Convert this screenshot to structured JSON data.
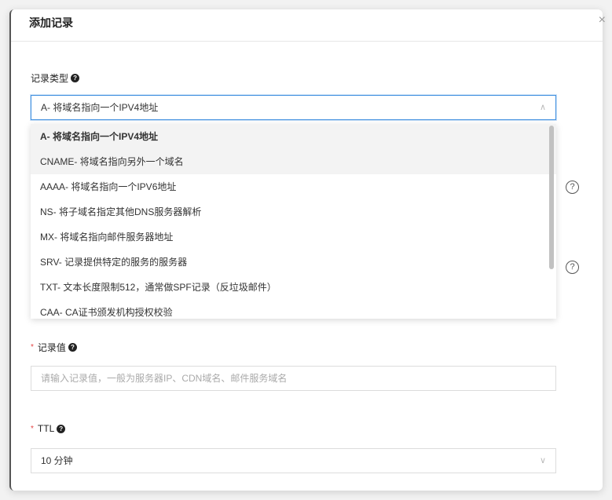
{
  "modal": {
    "title": "添加记录",
    "close": "×"
  },
  "record_type": {
    "label": "记录类型",
    "help": "?",
    "value": "A- 将域名指向一个IPV4地址",
    "arrow": "∧",
    "options": [
      "A- 将域名指向一个IPV4地址",
      "CNAME- 将域名指向另外一个域名",
      "AAAA- 将域名指向一个IPV6地址",
      "NS- 将子域名指定其他DNS服务器解析",
      "MX- 将域名指向邮件服务器地址",
      "SRV- 记录提供特定的服务的服务器",
      "TXT- 文本长度限制512，通常做SPF记录（反垃圾邮件）",
      "CAA- CA证书颁发机构授权校验"
    ]
  },
  "side_help": [
    "?",
    "?"
  ],
  "record_value": {
    "required": "*",
    "label": "记录值",
    "help": "?",
    "placeholder": "请输入记录值，一般为服务器IP、CDN域名、邮件服务域名"
  },
  "ttl": {
    "required": "*",
    "label": "TTL",
    "help": "?",
    "value": "10 分钟",
    "arrow": "∨"
  }
}
